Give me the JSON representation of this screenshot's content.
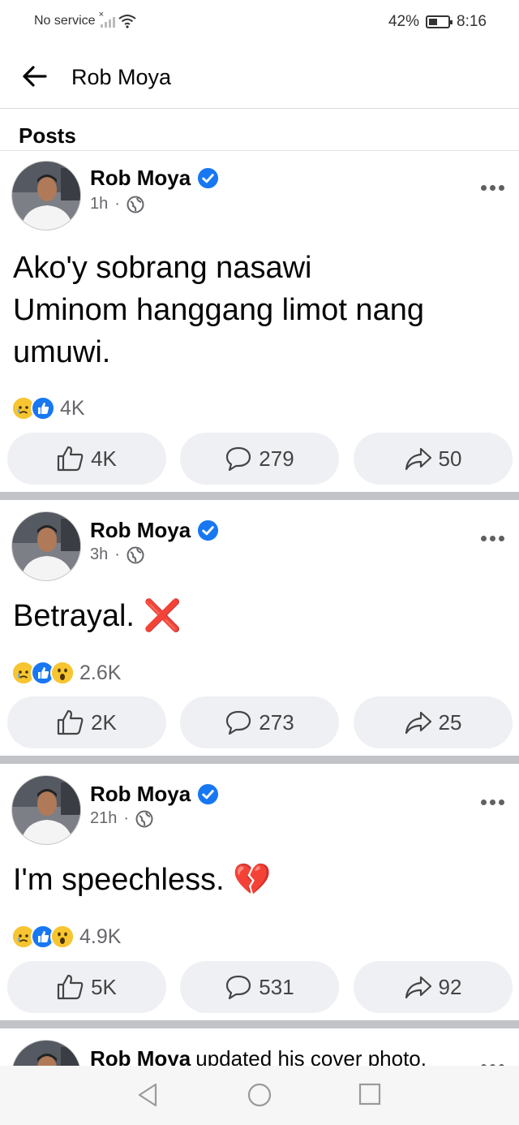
{
  "status": {
    "carrier": "No service",
    "battery": "42%",
    "time": "8:16"
  },
  "header": {
    "title": "Rob Moya"
  },
  "section": {
    "title": "Posts"
  },
  "posts": [
    {
      "author": "Rob Moya",
      "time": "1h",
      "text": "Ako'y sobrang nasawi\nUminom hanggang limot nang umuwi.",
      "reaction_count": "4K",
      "like_label": "4K",
      "comment_label": "279",
      "share_label": "50"
    },
    {
      "author": "Rob Moya",
      "time": "3h",
      "text": "Betrayal. ❌",
      "reaction_count": "2.6K",
      "like_label": "2K",
      "comment_label": "273",
      "share_label": "25"
    },
    {
      "author": "Rob Moya",
      "time": "21h",
      "text": "I'm speechless. 💔",
      "reaction_count": "4.9K",
      "like_label": "5K",
      "comment_label": "531",
      "share_label": "92"
    }
  ],
  "partial_post": {
    "author": "Rob Moya",
    "action": "updated his cover photo."
  },
  "colors": {
    "accent": "#1877f2",
    "divider": "#c1c3c8",
    "button_bg": "#eef0f3"
  }
}
